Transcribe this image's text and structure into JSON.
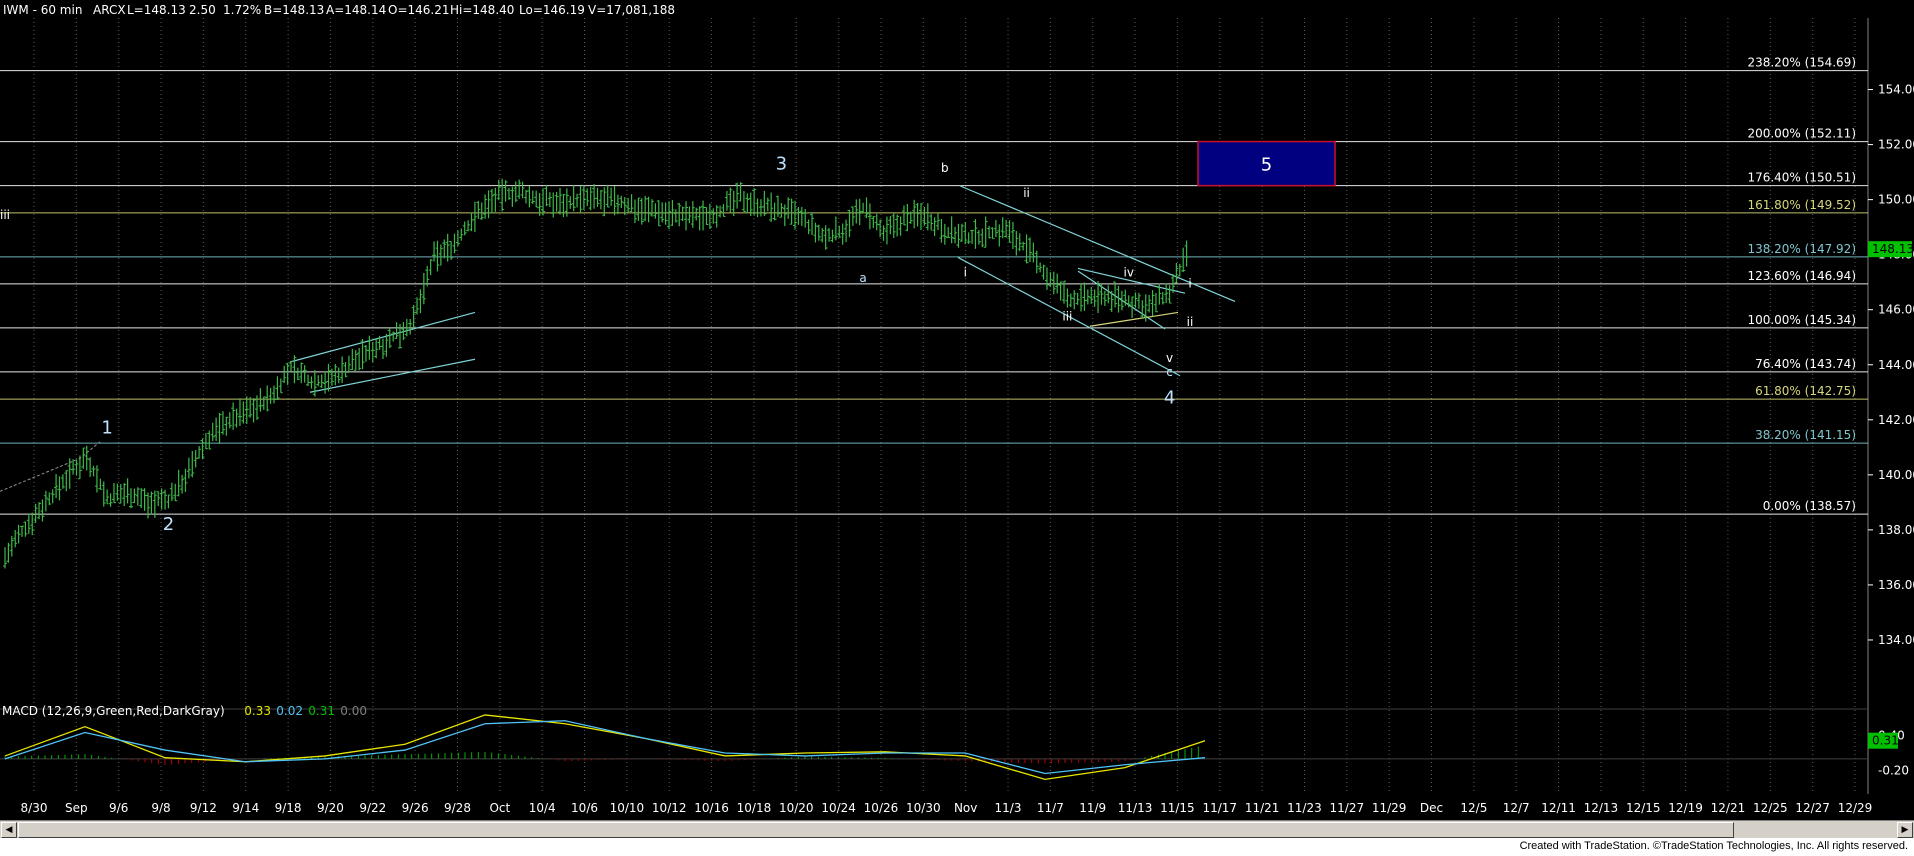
{
  "header": {
    "symbol": "IWM - 60 min",
    "exchange": "ARCX",
    "last": "L=148.13",
    "change": "2.50",
    "change_pct": "1.72%",
    "bid": "B=148.13",
    "ask": "A=148.14",
    "open": "O=146.21",
    "high": "Hi=148.40",
    "low": "Lo=146.19",
    "volume": "V=17,081,188"
  },
  "chart_data": [
    {
      "type": "line",
      "panel": "price",
      "ylim": [
        131.6,
        156.6
      ],
      "yticks": [
        "154.00",
        "152.00",
        "150.00",
        "148.00",
        "146.00",
        "144.00",
        "142.00",
        "140.00",
        "138.00",
        "136.00",
        "134.00"
      ],
      "last_price_label": "148.13",
      "x": [
        "8/28",
        "8/29",
        "8/30",
        "8/31",
        "9/1",
        "9/3",
        "9/6",
        "9/7",
        "9/8",
        "9/9",
        "9/10",
        "9/13",
        "9/14",
        "9/15",
        "9/16",
        "9/17",
        "9/20",
        "9/21",
        "9/22",
        "9/23",
        "9/24",
        "9/27",
        "9/28",
        "9/29",
        "9/30",
        "10/1",
        "10/4",
        "10/5",
        "10/6",
        "10/7",
        "10/8",
        "10/11",
        "10/12",
        "10/13",
        "10/14",
        "10/15",
        "10/18",
        "10/19",
        "10/20",
        "10/21",
        "10/22",
        "10/25",
        "10/26",
        "10/27",
        "10/28",
        "10/29",
        "11/1",
        "11/2",
        "11/3",
        "11/4",
        "11/5",
        "11/8",
        "11/9",
        "11/10",
        "11/11",
        "11/12",
        "11/15",
        "11/16",
        "11/17"
      ],
      "series": [
        {
          "values": [
            137.0,
            138.1,
            139.0,
            139.9,
            140.7,
            139.1,
            139.4,
            139.0,
            139.1,
            140.1,
            141.4,
            142.0,
            142.4,
            142.8,
            143.9,
            143.4,
            143.5,
            144.1,
            144.6,
            145.0,
            145.6,
            147.9,
            148.4,
            149.4,
            150.1,
            150.3,
            150.0,
            149.9,
            150.0,
            150.0,
            149.9,
            149.7,
            149.6,
            149.4,
            149.4,
            149.6,
            150.1,
            149.8,
            149.6,
            149.3,
            148.6,
            148.9,
            149.7,
            148.7,
            149.3,
            149.5,
            148.9,
            148.6,
            148.8,
            148.9,
            148.2,
            147.2,
            146.4,
            146.4,
            146.5,
            146.3,
            146.1,
            146.6,
            148.2
          ]
        }
      ],
      "hlines": [
        {
          "label": "238.20% (154.69)",
          "value": 154.69,
          "color": "#ffffff"
        },
        {
          "label": "200.00% (152.11)",
          "value": 152.11,
          "color": "#ffffff"
        },
        {
          "label": "176.40% (150.51)",
          "value": 150.51,
          "color": "#ffffff"
        },
        {
          "label": "161.80% (149.52)",
          "value": 149.52,
          "color": "#d6d67a"
        },
        {
          "label": "138.20% (147.92)",
          "value": 147.92,
          "color": "#7fc7cf"
        },
        {
          "label": "123.60% (146.94)",
          "value": 146.94,
          "color": "#ffffff"
        },
        {
          "label": "100.00% (145.34)",
          "value": 145.34,
          "color": "#ffffff"
        },
        {
          "label": "76.40% (143.74)",
          "value": 143.74,
          "color": "#ffffff"
        },
        {
          "label": "61.80% (142.75)",
          "value": 142.75,
          "color": "#d6d67a"
        },
        {
          "label": "38.20% (141.15)",
          "value": 141.15,
          "color": "#7fc7cf"
        },
        {
          "label": "0.00% (138.57)",
          "value": 138.57,
          "color": "#ffffff"
        }
      ],
      "wave_labels": [
        {
          "text": "1",
          "x": "9/3",
          "value": 141.5,
          "color": "#bfe3ff",
          "size": "large"
        },
        {
          "text": "2",
          "x": "9/8",
          "value": 138.0,
          "color": "#bfe3ff",
          "size": "large"
        },
        {
          "text": "3",
          "x": "10/20",
          "value": 151.1,
          "color": "#bfe3ff",
          "size": "large"
        },
        {
          "text": "a",
          "x": "10/26",
          "value": 147.0,
          "color": "#bfe3ff",
          "size": "small"
        },
        {
          "text": "b",
          "x": "11/1",
          "value": 151.0,
          "color": "#ffffff",
          "size": "small"
        },
        {
          "text": "i",
          "x": "11/2",
          "value": 147.2,
          "color": "#ffffff",
          "size": "small"
        },
        {
          "text": "ii",
          "x": "11/5",
          "value": 150.1,
          "color": "#ffffff",
          "size": "small"
        },
        {
          "text": "iii",
          "x": "11/9",
          "value": 145.6,
          "color": "#ffffff",
          "size": "small"
        },
        {
          "text": "iv",
          "x": "11/12",
          "value": 147.2,
          "color": "#ffffff",
          "size": "small"
        },
        {
          "text": "v",
          "x": "11/16",
          "value": 144.1,
          "color": "#ffffff",
          "size": "small"
        },
        {
          "text": "c",
          "x": "11/16",
          "value": 143.6,
          "color": "#bfe3ff",
          "size": "small"
        },
        {
          "text": "4",
          "x": "11/16",
          "value": 142.6,
          "color": "#bfe3ff",
          "size": "large"
        },
        {
          "text": "i",
          "x": "11/17",
          "value": 146.8,
          "color": "#ffffff",
          "size": "small"
        },
        {
          "text": "ii",
          "x": "11/17",
          "value": 145.4,
          "color": "#ffffff",
          "size": "small"
        },
        {
          "text": "iii",
          "x": "11/19",
          "value": 149.3,
          "color": "#ffffff",
          "size": "small"
        }
      ],
      "target_box": {
        "label": "5",
        "from": "11/18",
        "to": "11/27",
        "low": 150.51,
        "high": 152.11,
        "fill": "#000080",
        "border": "#c8102e"
      }
    },
    {
      "type": "line",
      "panel": "macd",
      "title": "MACD (12,26,9,Green,Red,DarkGray)",
      "values_text": [
        {
          "text": "0.33",
          "color": "#e6e600"
        },
        {
          "text": "0.02",
          "color": "#4fc3f7"
        },
        {
          "text": "0.31",
          "color": "#00c000"
        },
        {
          "text": "0.00",
          "color": "#808080"
        }
      ],
      "ylim": [
        -0.6,
        0.8
      ],
      "yticks": [
        "0.40",
        "-0.20"
      ],
      "last_value_label": "0.31",
      "x": [
        "8/28",
        "9/3",
        "9/9",
        "9/15",
        "9/21",
        "9/27",
        "10/1",
        "10/7",
        "10/13",
        "10/19",
        "10/25",
        "10/29",
        "11/4",
        "11/9",
        "11/12",
        "11/17"
      ],
      "series": [
        {
          "name": "MACD",
          "values": [
            0.05,
            0.55,
            0.02,
            -0.05,
            0.05,
            0.25,
            0.75,
            0.6,
            0.35,
            0.05,
            0.1,
            0.12,
            0.05,
            -0.35,
            -0.15,
            0.31
          ]
        },
        {
          "name": "Avg",
          "values": [
            0.0,
            0.45,
            0.15,
            -0.05,
            0.0,
            0.15,
            0.6,
            0.65,
            0.35,
            0.1,
            0.05,
            0.1,
            0.1,
            -0.25,
            -0.1,
            0.02
          ]
        }
      ]
    }
  ],
  "x_axis": {
    "ticks": [
      "8/30",
      "Sep",
      "9/6",
      "9/8",
      "9/12",
      "9/14",
      "9/18",
      "9/20",
      "9/22",
      "9/26",
      "9/28",
      "Oct",
      "10/4",
      "10/6",
      "10/10",
      "10/12",
      "10/16",
      "10/18",
      "10/20",
      "10/24",
      "10/26",
      "10/30",
      "Nov",
      "11/3",
      "11/7",
      "11/9",
      "11/13",
      "11/15",
      "11/17",
      "11/21",
      "11/23",
      "11/27",
      "11/29",
      "Dec",
      "12/5",
      "12/7",
      "12/11",
      "12/13",
      "12/15",
      "12/19",
      "12/21",
      "12/25",
      "12/27",
      "12/29"
    ]
  },
  "footer": {
    "credit": "Created with TradeStation. ©TradeStation Technologies, Inc. All rights reserved."
  },
  "colors": {
    "background": "#000000",
    "price_bars": "#3fb94a",
    "grid": "#5a5a5a",
    "axis_text": "#ffffff",
    "last_price_bg": "#00c000"
  }
}
